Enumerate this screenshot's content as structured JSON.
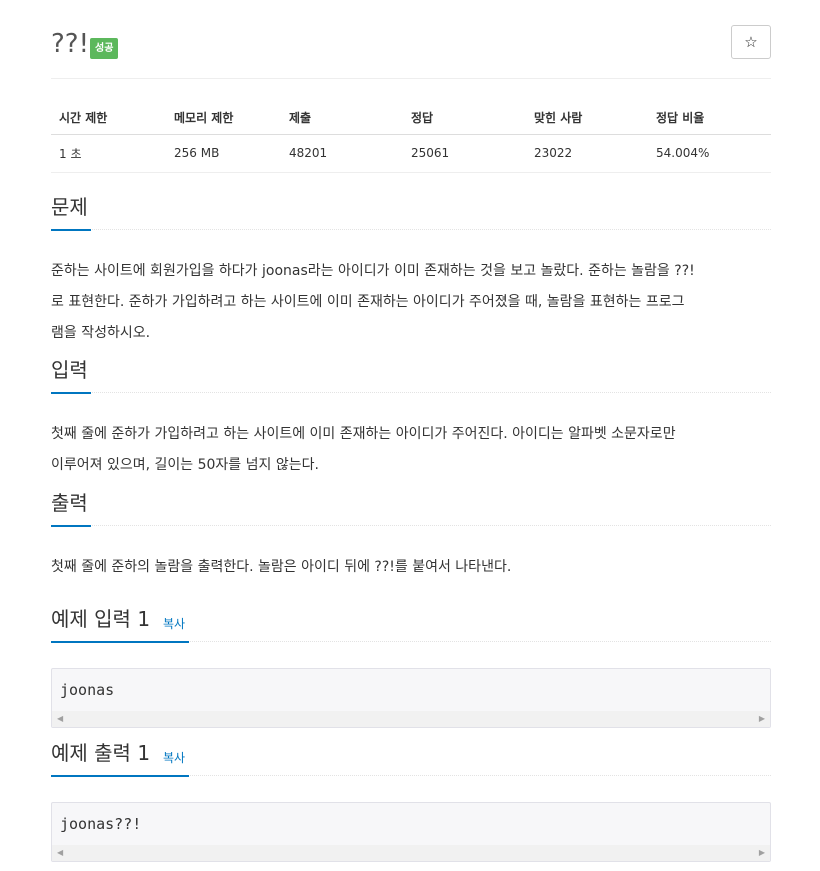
{
  "problem": {
    "title": "??!",
    "status_badge": "성공",
    "star_icon": "☆"
  },
  "info_table": {
    "headers": [
      "시간 제한",
      "메모리 제한",
      "제출",
      "정답",
      "맞힌 사람",
      "정답 비율"
    ],
    "values": [
      "1 초",
      "256 MB",
      "48201",
      "25061",
      "23022",
      "54.004%"
    ]
  },
  "sections": {
    "description": {
      "heading": "문제",
      "lines": [
        "준하는 사이트에 회원가입을 하다가 joonas라는 아이디가 이미 존재하는 것을 보고 놀랐다. 준하는 놀람을 ??!",
        "로 표현한다. 준하가 가입하려고 하는 사이트에 이미 존재하는 아이디가 주어졌을 때, 놀람을 표현하는 프로그",
        "램을 작성하시오."
      ]
    },
    "input": {
      "heading": "입력",
      "lines": [
        "첫째 줄에 준하가 가입하려고 하는 사이트에 이미 존재하는 아이디가 주어진다. 아이디는 알파벳 소문자로만",
        "이루어져 있으며, 길이는 50자를 넘지 않는다."
      ]
    },
    "output": {
      "heading": "출력",
      "lines": [
        "첫째 줄에 준하의 놀람을 출력한다. 놀람은 아이디 뒤에 ??!를 붙여서 나타낸다."
      ]
    }
  },
  "samples": {
    "input": {
      "heading": "예제 입력 1",
      "copy_label": "복사",
      "content": "joonas"
    },
    "output": {
      "heading": "예제 출력 1",
      "copy_label": "복사",
      "content": "joonas??!"
    }
  },
  "scroll_arrows": {
    "left": "◀",
    "right": "▶"
  },
  "colors": {
    "accent": "#0076c0",
    "success": "#5cb85c"
  }
}
